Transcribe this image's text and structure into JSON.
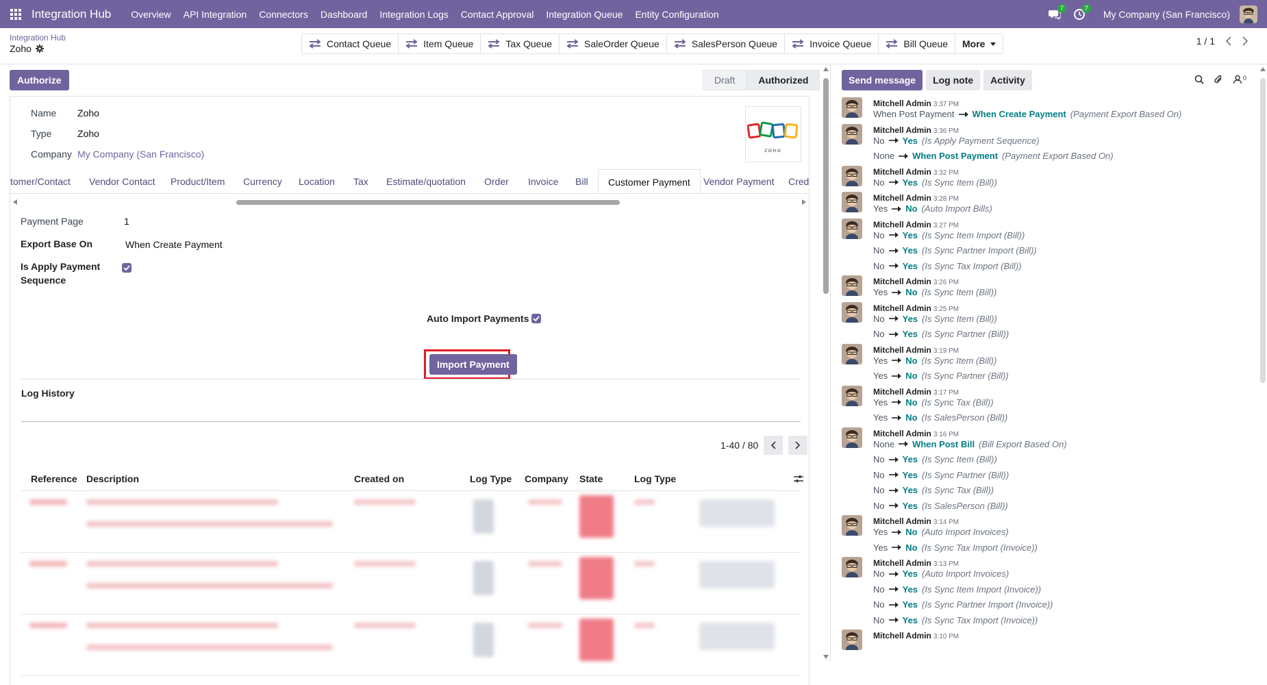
{
  "navbar": {
    "brand": "Integration Hub",
    "menu": [
      "Overview",
      "API Integration",
      "Connectors",
      "Dashboard",
      "Integration Logs",
      "Contact Approval",
      "Integration Queue",
      "Entity Configuration"
    ],
    "messages_count": "7",
    "activities_count": "7",
    "company": "My Company (San Francisco)"
  },
  "breadcrumb": {
    "parent": "Integration Hub",
    "current": "Zoho"
  },
  "smart_buttons": [
    "Contact Queue",
    "Item Queue",
    "Tax Queue",
    "SaleOrder Queue",
    "SalesPerson Queue",
    "Invoice Queue",
    "Bill Queue"
  ],
  "more_label": "More",
  "pager": {
    "value": "1 / 1"
  },
  "authorize_label": "Authorize",
  "status": {
    "draft": "Draft",
    "authorized": "Authorized"
  },
  "fields": {
    "name_label": "Name",
    "name_value": "Zoho",
    "type_label": "Type",
    "type_value": "Zoho",
    "company_label": "Company",
    "company_value": "My Company (San Francisco)",
    "logo_text": "ZOHO"
  },
  "tabs": [
    "tomer/Contact",
    "Vendor Contact",
    "Product/Item",
    "Currency",
    "Location",
    "Tax",
    "Estimate/quotation",
    "Order",
    "Invoice",
    "Bill",
    "Customer Payment",
    "Vendor Payment",
    "Credi"
  ],
  "payment": {
    "page_label": "Payment Page",
    "page_value": "1",
    "export_label": "Export Base On",
    "export_value": "When Create Payment",
    "sequence_label_1": "Is Apply Payment",
    "sequence_label_2": "Sequence",
    "auto_import_label": "Auto Import Payments",
    "import_button": "Import Payment"
  },
  "log_history": {
    "title": "Log History",
    "pager": "1-40 / 80",
    "columns": [
      "Reference",
      "Description",
      "Created on",
      "Log Type",
      "Company",
      "State",
      "Log Type"
    ]
  },
  "chatter": {
    "send_message": "Send message",
    "log_note": "Log note",
    "activity": "Activity",
    "followers_count": "0",
    "messages": [
      {
        "author": "Mitchell Admin",
        "time": "3:37 PM",
        "changes": [
          {
            "old": "When Post Payment",
            "new": "When Create Payment",
            "field": "(Payment Export Based On)"
          }
        ]
      },
      {
        "author": "Mitchell Admin",
        "time": "3:36 PM",
        "changes": [
          {
            "old": "No",
            "new": "Yes",
            "field": "(Is Apply Payment Sequence)"
          },
          {
            "old": "None",
            "new": "When Post Payment",
            "field": "(Payment Export Based On)"
          }
        ]
      },
      {
        "author": "Mitchell Admin",
        "time": "3:32 PM",
        "changes": [
          {
            "old": "No",
            "new": "Yes",
            "field": "(Is Sync Item (Bill))"
          }
        ]
      },
      {
        "author": "Mitchell Admin",
        "time": "3:28 PM",
        "changes": [
          {
            "old": "Yes",
            "new": "No",
            "field": "(Auto Import Bills)"
          }
        ]
      },
      {
        "author": "Mitchell Admin",
        "time": "3:27 PM",
        "changes": [
          {
            "old": "No",
            "new": "Yes",
            "field": "(Is Sync Item Import (Bill))"
          },
          {
            "old": "No",
            "new": "Yes",
            "field": "(Is Sync Partner Import (Bill))"
          },
          {
            "old": "No",
            "new": "Yes",
            "field": "(Is Sync Tax Import (Bill))"
          }
        ]
      },
      {
        "author": "Mitchell Admin",
        "time": "3:26 PM",
        "changes": [
          {
            "old": "Yes",
            "new": "No",
            "field": "(Is Sync Item (Bill))"
          }
        ]
      },
      {
        "author": "Mitchell Admin",
        "time": "3:25 PM",
        "changes": [
          {
            "old": "No",
            "new": "Yes",
            "field": "(Is Sync Item (Bill))"
          },
          {
            "old": "No",
            "new": "Yes",
            "field": "(Is Sync Partner (Bill))"
          }
        ]
      },
      {
        "author": "Mitchell Admin",
        "time": "3:19 PM",
        "changes": [
          {
            "old": "Yes",
            "new": "No",
            "field": "(Is Sync Item (Bill))"
          },
          {
            "old": "Yes",
            "new": "No",
            "field": "(Is Sync Partner (Bill))"
          }
        ]
      },
      {
        "author": "Mitchell Admin",
        "time": "3:17 PM",
        "changes": [
          {
            "old": "Yes",
            "new": "No",
            "field": "(Is Sync Tax (Bill))"
          },
          {
            "old": "Yes",
            "new": "No",
            "field": "(Is SalesPerson (Bill))"
          }
        ]
      },
      {
        "author": "Mitchell Admin",
        "time": "3:16 PM",
        "changes": [
          {
            "old": "None",
            "new": "When Post Bill",
            "field": "(Bill Export Based On)"
          },
          {
            "old": "No",
            "new": "Yes",
            "field": "(Is Sync Item (Bill))"
          },
          {
            "old": "No",
            "new": "Yes",
            "field": "(Is Sync Partner (Bill))"
          },
          {
            "old": "No",
            "new": "Yes",
            "field": "(Is Sync Tax (Bill))"
          },
          {
            "old": "No",
            "new": "Yes",
            "field": "(Is SalesPerson (Bill))"
          }
        ]
      },
      {
        "author": "Mitchell Admin",
        "time": "3:14 PM",
        "changes": [
          {
            "old": "Yes",
            "new": "No",
            "field": "(Auto Import Invoices)"
          },
          {
            "old": "Yes",
            "new": "No",
            "field": "(Is Sync Tax Import (Invoice))"
          }
        ]
      },
      {
        "author": "Mitchell Admin",
        "time": "3:13 PM",
        "changes": [
          {
            "old": "No",
            "new": "Yes",
            "field": "(Auto Import Invoices)"
          },
          {
            "old": "No",
            "new": "Yes",
            "field": "(Is Sync Item Import (Invoice))"
          },
          {
            "old": "No",
            "new": "Yes",
            "field": "(Is Sync Partner Import (Invoice))"
          },
          {
            "old": "No",
            "new": "Yes",
            "field": "(Is Sync Tax Import (Invoice))"
          }
        ]
      },
      {
        "author": "Mitchell Admin",
        "time": "3:10 PM",
        "changes": []
      }
    ]
  }
}
